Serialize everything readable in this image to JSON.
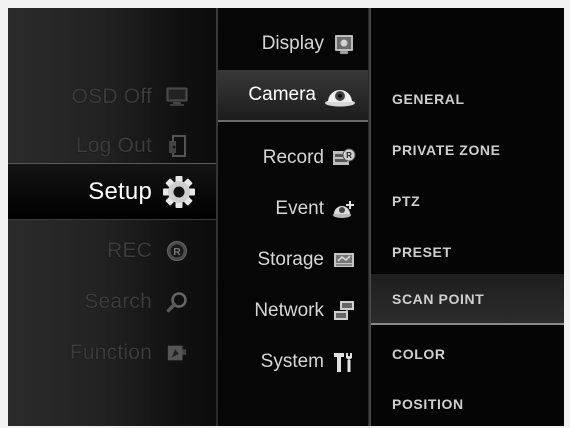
{
  "left_menu": {
    "items": [
      {
        "label": "OSD Off",
        "icon": "monitor-icon"
      },
      {
        "label": "Log Out",
        "icon": "logout-icon"
      },
      {
        "label": "Setup",
        "icon": "gear-icon",
        "selected": true
      },
      {
        "label": "REC",
        "icon": "record-icon"
      },
      {
        "label": "Search",
        "icon": "magnifier-icon"
      },
      {
        "label": "Function",
        "icon": "function-icon"
      }
    ]
  },
  "setup_menu": {
    "items": [
      {
        "label": "Display",
        "icon": "display-icon"
      },
      {
        "label": "Camera",
        "icon": "dome-camera-icon",
        "selected": true
      },
      {
        "label": "Record",
        "icon": "record-settings-icon"
      },
      {
        "label": "Event",
        "icon": "event-icon"
      },
      {
        "label": "Storage",
        "icon": "storage-icon"
      },
      {
        "label": "Network",
        "icon": "network-icon"
      },
      {
        "label": "System",
        "icon": "tools-icon"
      }
    ]
  },
  "camera_menu": {
    "items": [
      {
        "label": "GENERAL"
      },
      {
        "label": "PRIVATE ZONE"
      },
      {
        "label": "PTZ"
      },
      {
        "label": "PRESET"
      },
      {
        "label": "SCAN POINT",
        "selected": true
      },
      {
        "label": "COLOR"
      },
      {
        "label": "POSITION"
      }
    ]
  },
  "colors": {
    "background": "#070707",
    "selected_text": "#ffffff",
    "inactive_text": "#3d3d3d",
    "menu_text": "#d6d6d6"
  }
}
